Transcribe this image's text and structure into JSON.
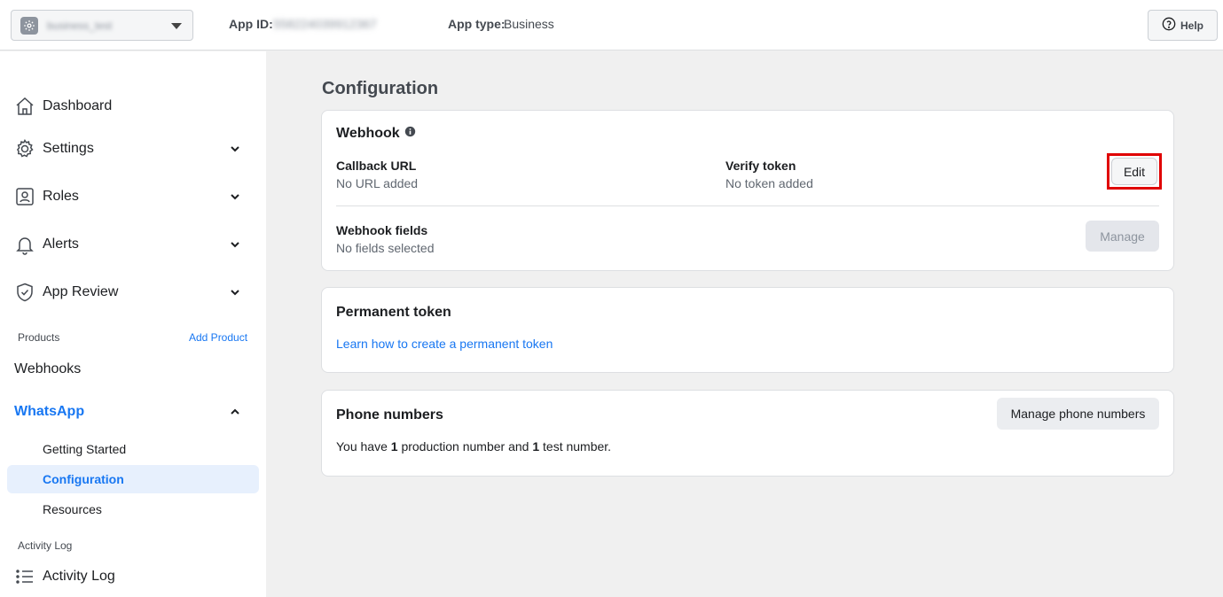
{
  "topbar": {
    "app_name": "business_test",
    "app_id_label": "App ID:",
    "app_id_value": "558224039912367",
    "app_type_label": "App type:",
    "app_type_value": "Business",
    "help_label": "Help"
  },
  "sidebar": {
    "dashboard": "Dashboard",
    "settings": "Settings",
    "roles": "Roles",
    "alerts": "Alerts",
    "app_review": "App Review",
    "products_label": "Products",
    "add_product": "Add Product",
    "webhooks": "Webhooks",
    "whatsapp": "WhatsApp",
    "getting_started": "Getting Started",
    "configuration": "Configuration",
    "resources": "Resources",
    "activity_log_label": "Activity Log",
    "activity_log": "Activity Log"
  },
  "main": {
    "title": "Configuration",
    "webhook": {
      "title": "Webhook",
      "callback_url_label": "Callback URL",
      "callback_url_value": "No URL added",
      "verify_token_label": "Verify token",
      "verify_token_value": "No token added",
      "edit_label": "Edit",
      "fields_label": "Webhook fields",
      "fields_value": "No fields selected",
      "manage_label": "Manage"
    },
    "permanent_token": {
      "title": "Permanent token",
      "link": "Learn how to create a permanent token"
    },
    "phone_numbers": {
      "title": "Phone numbers",
      "manage_label": "Manage phone numbers",
      "text_prefix": "You have ",
      "production_count": "1",
      "text_middle": " production number and ",
      "test_count": "1",
      "text_suffix": " test number."
    }
  },
  "colors": {
    "accent": "#1877f2",
    "highlight": "#e00000",
    "active_bg": "#e7f0fd"
  }
}
